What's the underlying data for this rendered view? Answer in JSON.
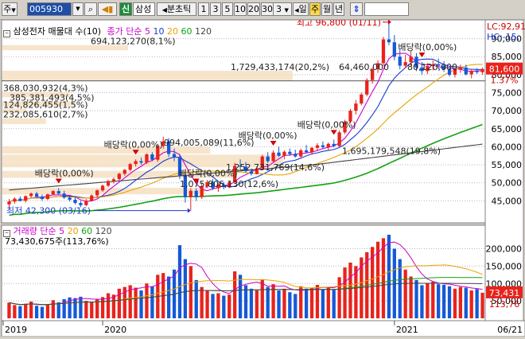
{
  "toolbar": {
    "mode_label": "주",
    "code_value": "005930",
    "new_badge": "신",
    "stock_name": "삼성",
    "period_label": "분초틱",
    "periods": [
      "1",
      "3",
      "5",
      "10",
      "20",
      "30"
    ],
    "count_value": "3",
    "day_label": "일",
    "week_label": "주",
    "month_label": "월",
    "year_label": "년"
  },
  "price_panel": {
    "legend_title": "삼성전자 매물대 수(10)",
    "ma_label": "종가 단순",
    "ma_periods": [
      "5",
      "10",
      "20",
      "60",
      "120"
    ],
    "ma_colors": [
      "#cc00cc",
      "#1a3ccc",
      "#e8a400",
      "#15a015",
      "#444444"
    ],
    "high_annotation": "최고 96,800 (01/11)",
    "low_annotation": "최저 42,300 (03/16)",
    "dividend_label": "배당락(0,00%)",
    "current_price": "81,600",
    "current_pct": "1.37%",
    "right_labels": [
      "LC:92,91",
      "HC:-15,"
    ],
    "y_ticks": [
      "90,000",
      "85,000",
      "80,000",
      "75,000",
      "70,000",
      "65,000",
      "60,000",
      "55,000",
      "50,000",
      "45,000"
    ],
    "volume_profile": [
      {
        "label": "694,123,270(8,1%)"
      },
      {
        "label": "1,729,433,174(20,2%)"
      },
      {
        "label": "368,030,932(4,3%)"
      },
      {
        "label": "385,381,493(4,5%)"
      },
      {
        "label": "124,826,455(1,5%)"
      },
      {
        "label": "232,085,610(2,7%)"
      },
      {
        "label": "1,695,179,548(19,8%)"
      },
      {
        "label": "1,252,731,769(14,6%)"
      },
      {
        "label": "1,075,806,130(12,6%)"
      },
      {
        "label": "994,005,089(11,6%)"
      },
      {
        "label": "64,460,000"
      },
      {
        "label": "80,120,000"
      }
    ]
  },
  "volume_panel": {
    "legend_title": "거래량 단순",
    "ma_periods": [
      "5",
      "20",
      "60",
      "120"
    ],
    "last_volume": "73,430,675주(113,76%)",
    "current_volume": "73,431",
    "current_pct": "113,76",
    "y_ticks": [
      "200,000",
      "150,000",
      "100,000",
      "50,000"
    ]
  },
  "x_axis": {
    "labels": [
      "2019",
      "2020",
      "2021",
      "06/21"
    ]
  },
  "chart_data": {
    "type": "candlestick",
    "interval": "weekly",
    "symbol": "005930",
    "price_ylim": [
      40000,
      93000
    ],
    "volume_ylim": [
      0,
      240000
    ],
    "volume_unit": "thousand shares",
    "high": {
      "value": 96800,
      "date": "01/11"
    },
    "low": {
      "value": 42300,
      "date": "03/16"
    },
    "last_close": 81600,
    "last_volume": 73431,
    "series": [
      {
        "name": "candles",
        "values": [
          [
            44000,
            45500,
            43000,
            44800
          ],
          [
            44800,
            46000,
            44200,
            45600
          ],
          [
            45600,
            46200,
            44800,
            45000
          ],
          [
            45000,
            46500,
            44500,
            46300
          ],
          [
            46300,
            47300,
            45800,
            47000
          ],
          [
            47000,
            47500,
            45800,
            46200
          ],
          [
            46200,
            46800,
            45000,
            45500
          ],
          [
            45500,
            47000,
            45200,
            46800
          ],
          [
            46800,
            48000,
            46500,
            47700
          ],
          [
            47700,
            48500,
            46700,
            47000
          ],
          [
            47000,
            47800,
            45500,
            45900
          ],
          [
            45900,
            46500,
            44800,
            45300
          ],
          [
            45300,
            46000,
            44000,
            44400
          ],
          [
            44400,
            45000,
            43200,
            43800
          ],
          [
            43800,
            45500,
            43500,
            45000
          ],
          [
            45000,
            46800,
            44800,
            46500
          ],
          [
            46500,
            48200,
            46000,
            47900
          ],
          [
            47900,
            49500,
            47500,
            49200
          ],
          [
            49200,
            50800,
            48800,
            50500
          ],
          [
            50500,
            51500,
            49800,
            51000
          ],
          [
            51000,
            52800,
            50600,
            52500
          ],
          [
            52500,
            53800,
            52000,
            53600
          ],
          [
            53600,
            55500,
            53200,
            55200
          ],
          [
            55200,
            56500,
            54500,
            56000
          ],
          [
            56000,
            57000,
            55000,
            55600
          ],
          [
            55600,
            58200,
            55200,
            57900
          ],
          [
            57900,
            58500,
            56000,
            56400
          ],
          [
            56400,
            60800,
            55800,
            60200
          ],
          [
            60200,
            62800,
            59500,
            61500
          ],
          [
            61500,
            62400,
            57200,
            58000
          ],
          [
            58000,
            59500,
            56000,
            57200
          ],
          [
            57200,
            58000,
            51000,
            52000
          ],
          [
            52000,
            52500,
            44500,
            46000
          ],
          [
            46000,
            48500,
            42300,
            47800
          ],
          [
            47800,
            48500,
            45000,
            46000
          ],
          [
            46000,
            50000,
            45500,
            49000
          ],
          [
            49000,
            50800,
            48500,
            50200
          ],
          [
            50200,
            51000,
            48000,
            48500
          ],
          [
            48500,
            50000,
            47500,
            49500
          ],
          [
            49500,
            50200,
            48200,
            48800
          ],
          [
            48800,
            50500,
            48500,
            50100
          ],
          [
            50100,
            55500,
            49800,
            54700
          ],
          [
            54700,
            56500,
            53500,
            54500
          ],
          [
            54500,
            55800,
            52800,
            53200
          ],
          [
            53200,
            54000,
            52000,
            52500
          ],
          [
            52500,
            54500,
            52300,
            54000
          ],
          [
            54000,
            57800,
            53500,
            57300
          ],
          [
            57300,
            58500,
            55500,
            56000
          ],
          [
            56000,
            59000,
            55800,
            58400
          ],
          [
            58400,
            60000,
            57200,
            57500
          ],
          [
            57500,
            59000,
            56500,
            58600
          ],
          [
            58600,
            59500,
            57500,
            58000
          ],
          [
            58000,
            59200,
            57000,
            57300
          ],
          [
            57300,
            59500,
            57000,
            59000
          ],
          [
            59000,
            60500,
            58200,
            58500
          ],
          [
            58500,
            60000,
            57800,
            59700
          ],
          [
            59700,
            61000,
            58800,
            60400
          ],
          [
            60400,
            61500,
            59500,
            59900
          ],
          [
            59900,
            61200,
            59000,
            60800
          ],
          [
            60800,
            62000,
            59800,
            60200
          ],
          [
            60200,
            64500,
            60000,
            64000
          ],
          [
            64000,
            67500,
            63500,
            67000
          ],
          [
            67000,
            70500,
            66500,
            70000
          ],
          [
            70000,
            73000,
            69000,
            72000
          ],
          [
            72000,
            75000,
            71500,
            74500
          ],
          [
            74500,
            79000,
            74000,
            78500
          ],
          [
            78500,
            82000,
            77500,
            81500
          ],
          [
            81500,
            84000,
            80500,
            83200
          ],
          [
            83200,
            90500,
            82500,
            89800
          ],
          [
            89800,
            96800,
            88200,
            89000
          ],
          [
            89000,
            91000,
            84000,
            85000
          ],
          [
            85000,
            87000,
            81500,
            82500
          ],
          [
            82500,
            85500,
            81800,
            83500
          ],
          [
            83500,
            86500,
            82500,
            85000
          ],
          [
            85000,
            86000,
            81000,
            82000
          ],
          [
            82000,
            83500,
            80000,
            81000
          ],
          [
            81000,
            83200,
            80200,
            82400
          ],
          [
            82400,
            84000,
            81200,
            82900
          ],
          [
            82900,
            84500,
            81500,
            82500
          ],
          [
            82500,
            83800,
            80800,
            81500
          ],
          [
            81500,
            82400,
            79500,
            80000
          ],
          [
            80000,
            82000,
            79200,
            81500
          ],
          [
            81500,
            82800,
            80500,
            82000
          ],
          [
            82000,
            82800,
            79800,
            80100
          ],
          [
            80100,
            81500,
            79000,
            81000
          ],
          [
            81000,
            81800,
            80200,
            80700
          ],
          [
            80700,
            82000,
            80000,
            81600
          ]
        ]
      },
      {
        "name": "volume",
        "values": [
          45000,
          38000,
          35000,
          42000,
          48000,
          36000,
          33000,
          40000,
          52000,
          46000,
          55000,
          60000,
          58000,
          62000,
          50000,
          47000,
          56000,
          61000,
          72000,
          68000,
          85000,
          90000,
          95000,
          88000,
          80000,
          100000,
          92000,
          125000,
          130000,
          120000,
          140000,
          210000,
          170000,
          150000,
          110000,
          90000,
          80000,
          70000,
          72000,
          65000,
          68000,
          135000,
          125000,
          95000,
          85000,
          80000,
          112000,
          90000,
          98000,
          80000,
          85000,
          75000,
          70000,
          92000,
          85000,
          88000,
          96000,
          83000,
          90000,
          82000,
          118000,
          146000,
          160000,
          150000,
          175000,
          190000,
          205000,
          220000,
          230000,
          240000,
          200000,
          170000,
          140000,
          120000,
          110000,
          95000,
          100000,
          105000,
          98000,
          96000,
          92000,
          85000,
          90000,
          88000,
          80000,
          84000,
          73431
        ]
      }
    ]
  }
}
